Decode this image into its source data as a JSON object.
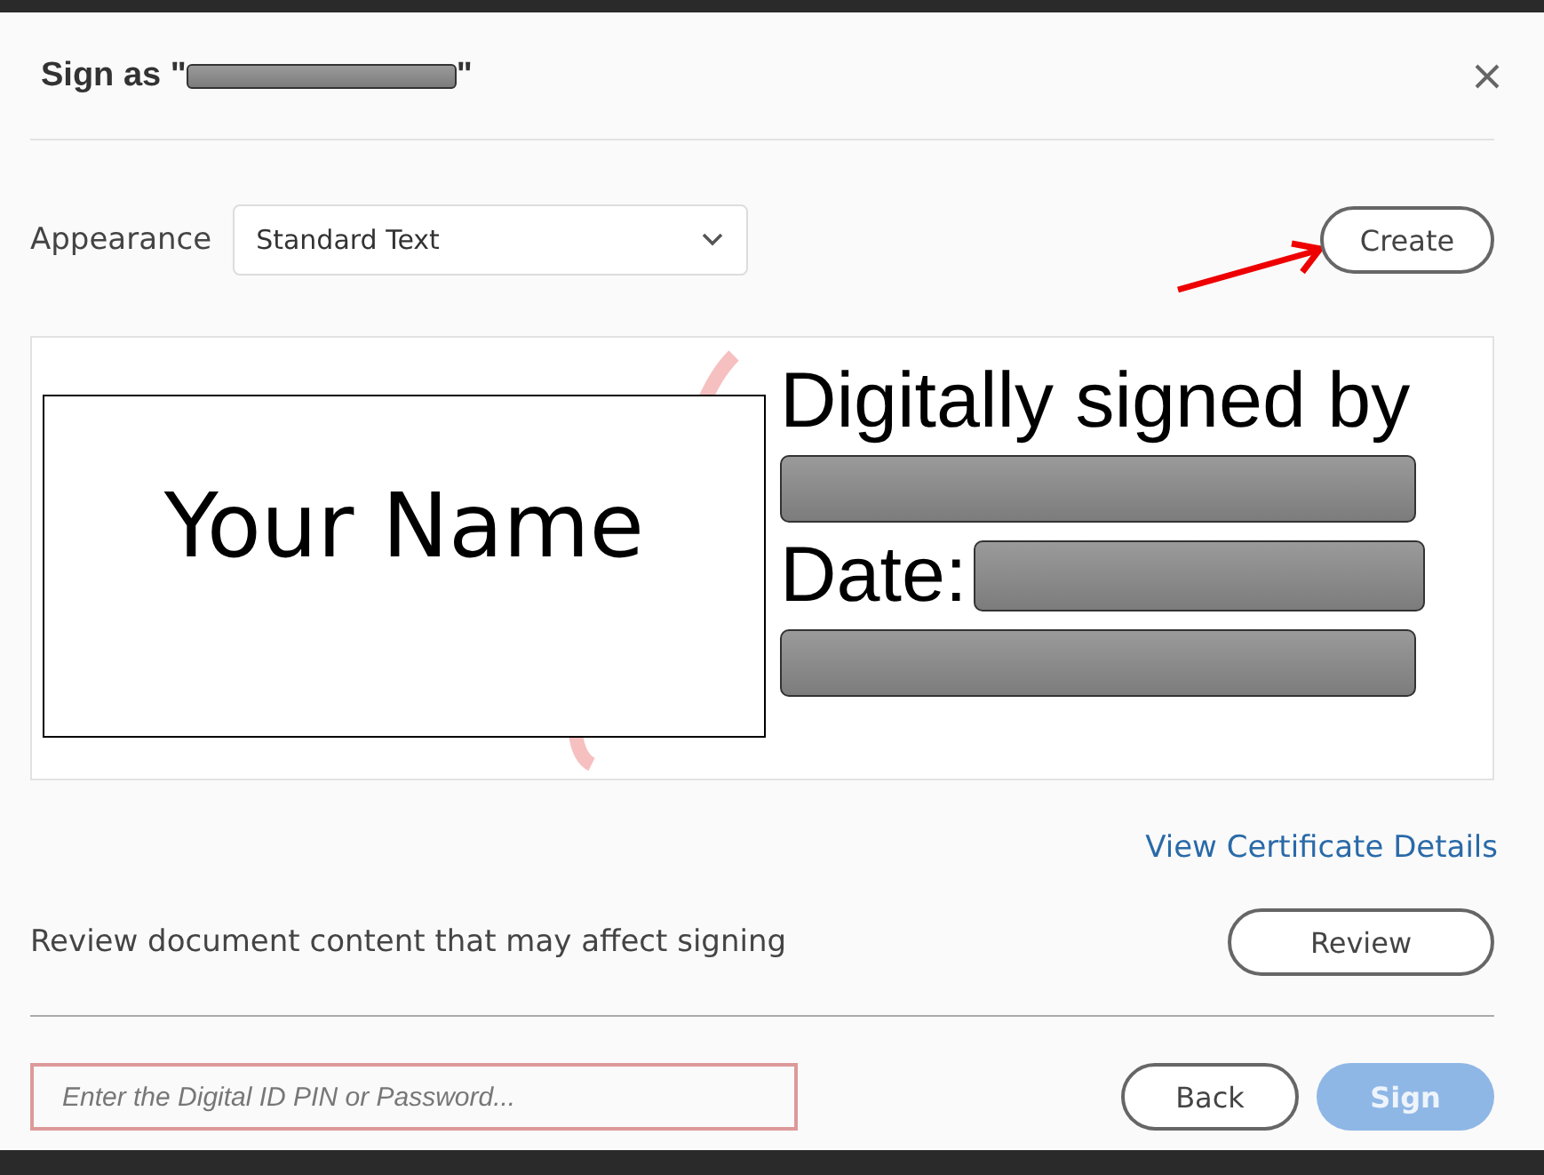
{
  "dialog": {
    "title_prefix": "Sign as \"",
    "title_suffix": "\""
  },
  "appearance": {
    "label": "Appearance",
    "value": "Standard Text"
  },
  "create_button": "Create",
  "preview": {
    "name_text": "Your Name",
    "signed_by": "Digitally signed by",
    "date_label": "Date:"
  },
  "certificate_link": "View Certificate Details",
  "review": {
    "text": "Review document content that may affect signing",
    "button": "Review"
  },
  "pin_field": {
    "placeholder": "Enter the Digital ID PIN or Password..."
  },
  "back_button": "Back",
  "sign_button": {
    "label": "Sign",
    "disabled": true
  }
}
